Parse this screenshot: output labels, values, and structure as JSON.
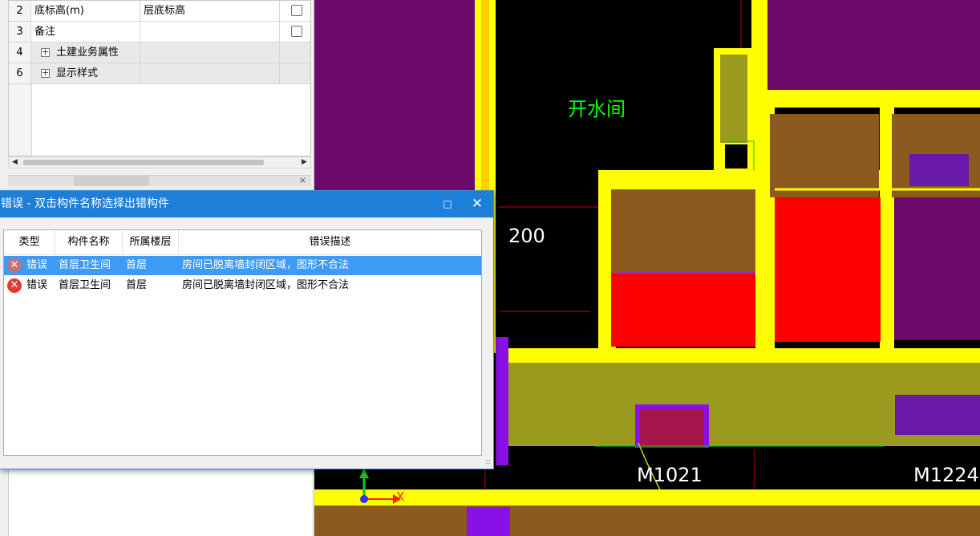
{
  "property_panel": {
    "rows": [
      {
        "num": "2",
        "name": "底标高(m)",
        "value": "层底标高",
        "type": "field"
      },
      {
        "num": "3",
        "name": "备注",
        "value": "",
        "type": "field"
      },
      {
        "num": "4",
        "name": "土建业务属性",
        "value": "",
        "type": "group",
        "expander": "+"
      },
      {
        "num": "6",
        "name": "显示样式",
        "value": "",
        "type": "group",
        "expander": "+"
      }
    ],
    "scroll_left": "◀",
    "scroll_right": "▶",
    "close_glyph": "×"
  },
  "error_dialog": {
    "title": "错误 - 双击构件名称选择出错构件",
    "maximize_glyph": "□",
    "close_glyph": "✕",
    "columns": [
      "类型",
      "构件名称",
      "所属楼层",
      "错误描述"
    ],
    "rows": [
      {
        "type": "错误",
        "name": "首层卫生间",
        "floor": "首层",
        "desc": "房间已脱离墙封闭区域，图形不合法",
        "selected": true
      },
      {
        "type": "错误",
        "name": "首层卫生间",
        "floor": "首层",
        "desc": "房间已脱离墙封闭区域，图形不合法",
        "selected": false
      }
    ],
    "error_icon_glyph": "✕",
    "grip_glyph": ":::"
  },
  "viewport": {
    "room_label": "开水间",
    "dimension_text": "200",
    "door_label_1": "M1021",
    "door_label_2": "M1224",
    "axis_x_label": "X",
    "colors": {
      "background": "#000000",
      "wall": "#ffff00",
      "slab_purple": "#6b0a6b",
      "room_brown": "#8c5a1e",
      "room_red": "#ff0000",
      "olive": "#9a9a1e",
      "violet_column": "#8a10e8",
      "text_green": "#00ff00",
      "grid_red": "#c00000"
    }
  }
}
